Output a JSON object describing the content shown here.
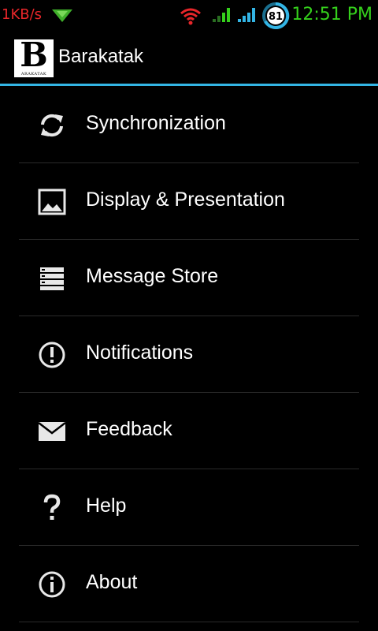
{
  "status_bar": {
    "net_speed": "1KB/s",
    "battery_level": "81",
    "time": "12:51 PM",
    "colors": {
      "net_speed": "#e8262a",
      "time": "#35d01c",
      "wifi": "#e8262a",
      "signal_green": "#35d01c",
      "signal_blue": "#33b5e5"
    }
  },
  "action_bar": {
    "logo_letter": "B",
    "logo_subtext": "ARAKATAK",
    "title": "Barakatak",
    "accent_color": "#33b5e5"
  },
  "menu": {
    "items": [
      {
        "label": "Synchronization",
        "icon": "sync-icon"
      },
      {
        "label": "Display & Presentation",
        "icon": "image-icon"
      },
      {
        "label": "Message Store",
        "icon": "storage-icon"
      },
      {
        "label": "Notifications",
        "icon": "alert-circle-icon"
      },
      {
        "label": "Feedback",
        "icon": "envelope-icon"
      },
      {
        "label": "Help",
        "icon": "question-icon"
      },
      {
        "label": "About",
        "icon": "info-icon"
      }
    ]
  }
}
